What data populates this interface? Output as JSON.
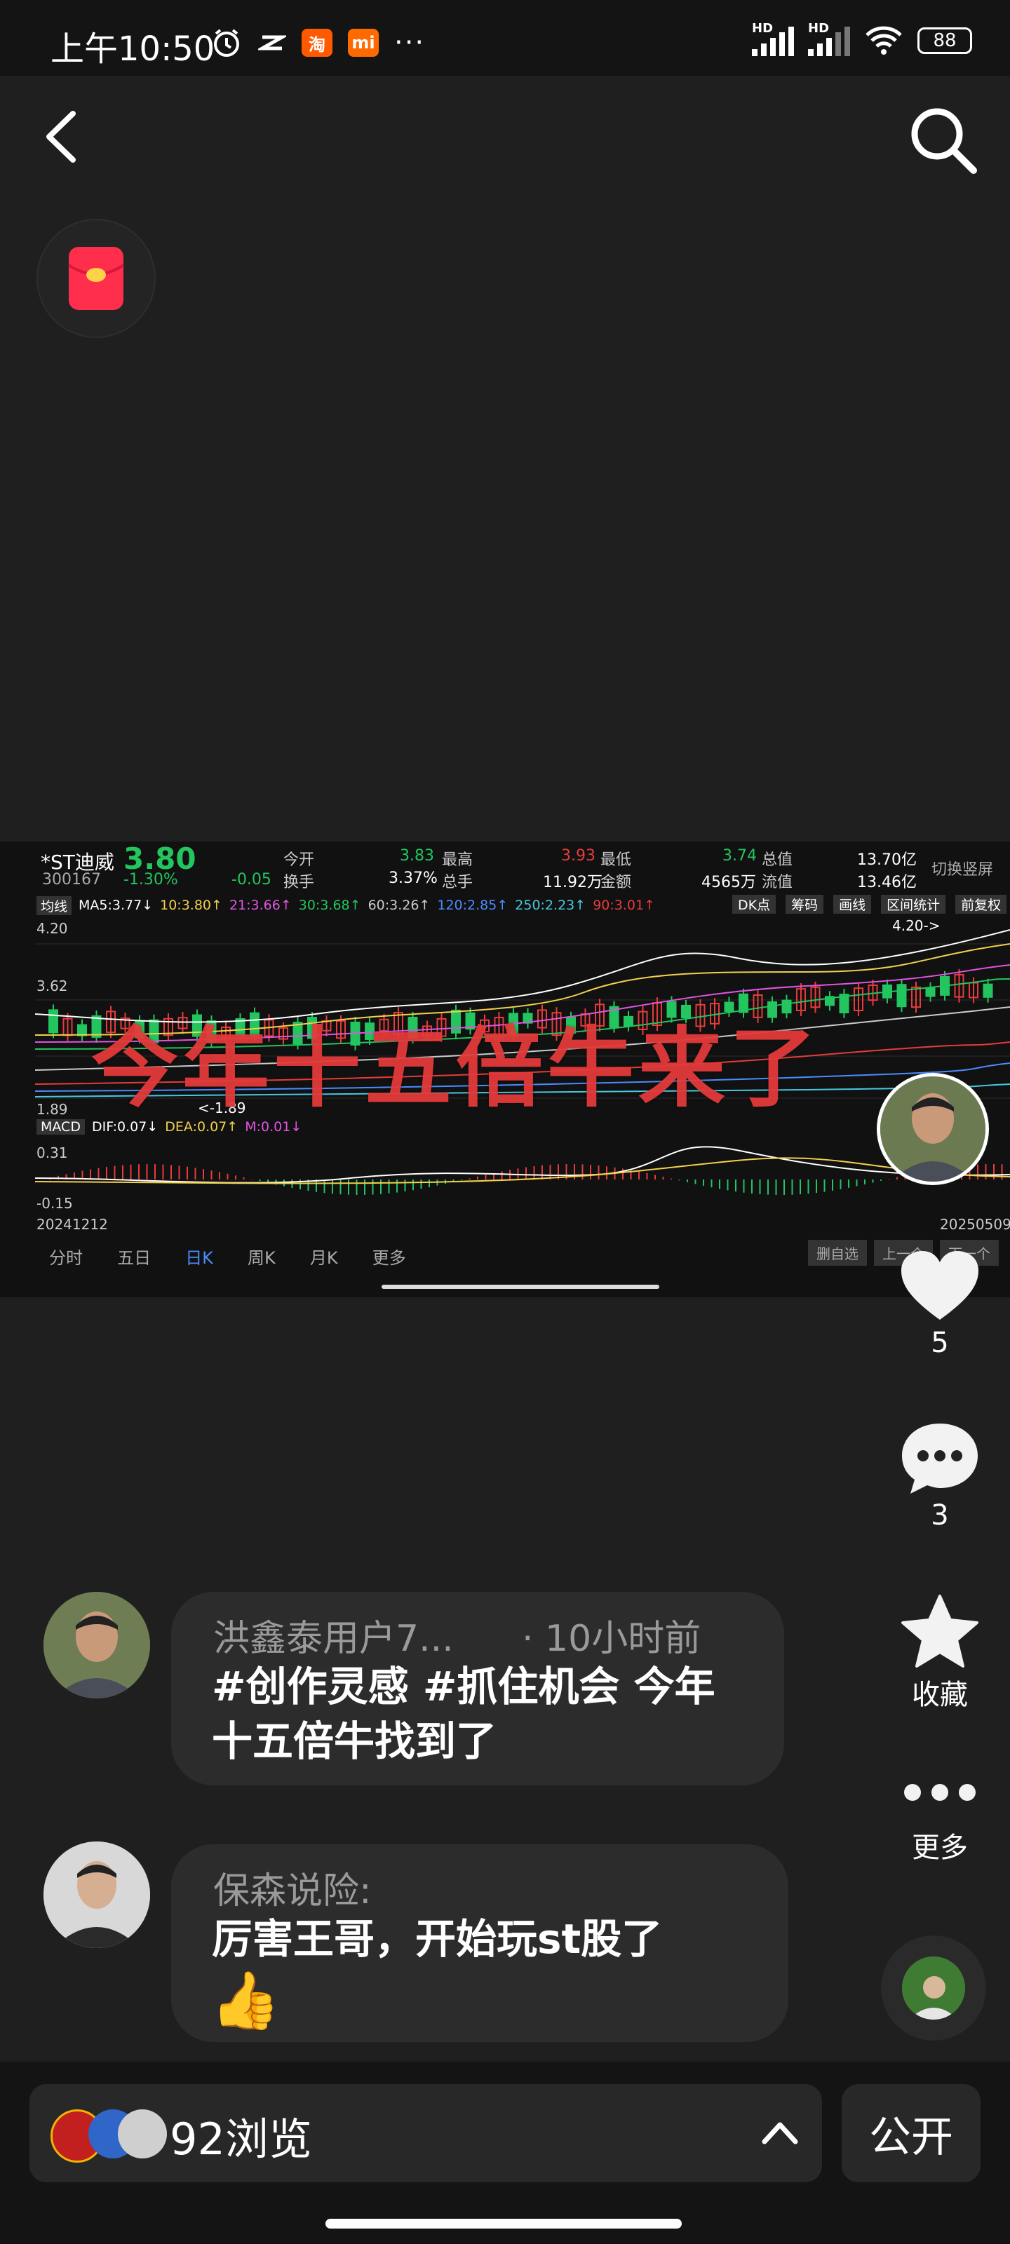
{
  "status_bar": {
    "time": "上午10:50",
    "app_badges": [
      "淘",
      "mi"
    ],
    "more_dots": "···",
    "network_left": "HD",
    "network_right": "HD",
    "battery": "88"
  },
  "nav": {
    "back_icon": "chevron-left-icon",
    "search_icon": "search-icon"
  },
  "stock": {
    "name": "*ST迪威",
    "code": "300167",
    "price": "3.80",
    "change_pct": "-1.30%",
    "change": "-0.05",
    "open_label": "今开",
    "open": "3.83",
    "high_label": "最高",
    "high": "3.93",
    "low_label": "最低",
    "low": "3.74",
    "total_value_label": "总值",
    "total_value": "13.70亿",
    "turnover_label": "换手",
    "turnover": "3.37%",
    "volume_label": "总手",
    "volume": "11.92万",
    "amount_label": "金额",
    "amount": "4565万",
    "float_label": "流值",
    "float_value": "13.46亿",
    "switch_label": "切换竖屏",
    "ma_line": "均线",
    "ma5": "MA5:3.77↓",
    "ma10": "10:3.80↑",
    "ma21": "21:3.66↑",
    "ma30": "30:3.68↑",
    "ma60": "60:3.26↑",
    "ma120": "120:2.85↑",
    "ma250": "250:2.23↑",
    "ma90": "90:3.01↑",
    "tool_buttons": [
      "DK点",
      "筹码",
      "画线",
      "区间统计",
      "前复权"
    ],
    "axis_top": "4.20",
    "axis_mid": "3.62",
    "axis_low": "1.89",
    "high_marker": "4.20->",
    "low_marker": "<-1.89",
    "macd_label": "MACD",
    "dif": "DIF:0.07↓",
    "dea": "DEA:0.07↑",
    "m": "M:0.01↓",
    "macd_top": "0.31",
    "macd_bottom": "-0.15",
    "date_start": "20241212",
    "date_end": "20250509",
    "period_tabs": [
      "分时",
      "五日",
      "日K",
      "周K",
      "月K",
      "更多"
    ],
    "bottom_buttons": [
      "删自选",
      "上一个",
      "下一个"
    ],
    "overlay_text": "今年十五倍牛来了"
  },
  "rail": {
    "like_count": "5",
    "comment_count": "3",
    "favorite_label": "收藏",
    "more_label": "更多"
  },
  "comments": [
    {
      "name": "洪鑫泰用户7...",
      "time": "· 10小时前",
      "text_line1": "#创作灵感 #抓住机会 今年",
      "text_line2": "十五倍牛找到了"
    },
    {
      "name": "保森说险:",
      "text_line1": "厉害王哥，开始玩st股了",
      "emoji": "👍"
    }
  ],
  "bottom_bar": {
    "views": "92浏览",
    "public": "公开"
  },
  "colors": {
    "up": "#e83b3b",
    "down": "#22c55e",
    "accent": "#ff2e4d",
    "macd_yellow": "#d9c36a",
    "macd_pink": "#e055e0"
  }
}
